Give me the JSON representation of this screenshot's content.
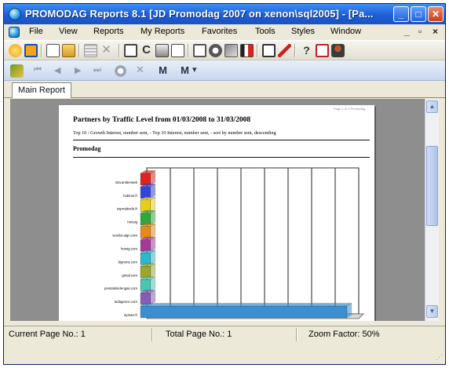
{
  "window": {
    "title": "PROMODAG Reports 8.1 [JD Promodag 2007 on xenon\\sql2005] - [Pa...",
    "min_label": "_",
    "max_label": "□",
    "close_label": "✕"
  },
  "menu": {
    "items": [
      "File",
      "View",
      "Reports",
      "My Reports",
      "Favorites",
      "Tools",
      "Styles",
      "Window"
    ],
    "mdi_min": "_",
    "mdi_restore": "▫",
    "mdi_close": "×"
  },
  "toolbar_icons": [
    "new-report-icon",
    "open-icon",
    "new-document-icon",
    "folder-icon",
    "list-icon",
    "delete-icon",
    "properties-icon",
    "refresh-icon",
    "print-icon",
    "export-icon",
    "preview-icon",
    "schedule-icon",
    "email-icon",
    "filter-icon",
    "layout-icon",
    "edit-icon",
    "help-icon",
    "pdf-icon",
    "users-icon"
  ],
  "report_toolbar": {
    "first": "⏮",
    "prev": "◀",
    "next": "▶",
    "last": "⏭",
    "find": "🔍",
    "zoom_dropdown_arrow": "▾"
  },
  "tabs": [
    "Main Report"
  ],
  "report": {
    "corner_text": "Page 1 of 1  Promodag",
    "title": "Partners by Traffic Level from 01/03/2008 to 31/03/2008",
    "subtitle": "Top 10 / Growth Interest, number sent, - Top 10 Interest, number sent, - sort by number sent, descending",
    "section": "Promodag"
  },
  "chart_data": {
    "type": "bar",
    "orientation": "horizontal",
    "categories": [
      "sita.amberweb",
      "hubinet.fr",
      "soprodexdo.fr",
      "hmtvig",
      "vendor.atgn.com",
      "horsig.com",
      "bignons.com",
      "gmail.com",
      "prestatdeclengas.com",
      "tudagence.com",
      "aymarr.fr"
    ],
    "values": [
      0,
      0,
      0,
      0,
      0,
      0,
      0,
      0,
      0,
      0,
      425
    ],
    "colors": [
      "#dd2222",
      "#3344dd",
      "#e6cf1a",
      "#2fa83a",
      "#e88a18",
      "#a8369a",
      "#2ab7cf",
      "#9aa82b",
      "#4cc5b5",
      "#8a5ab8",
      "#3a8fd0"
    ],
    "xticks": [
      0,
      50,
      100,
      150,
      200,
      250,
      300,
      350,
      400,
      450
    ],
    "xlim": [
      0,
      450
    ],
    "grid": true
  },
  "status": {
    "current_page": "Current Page No.: 1",
    "total_page": "Total Page No.: 1",
    "zoom": "Zoom Factor: 50%"
  }
}
